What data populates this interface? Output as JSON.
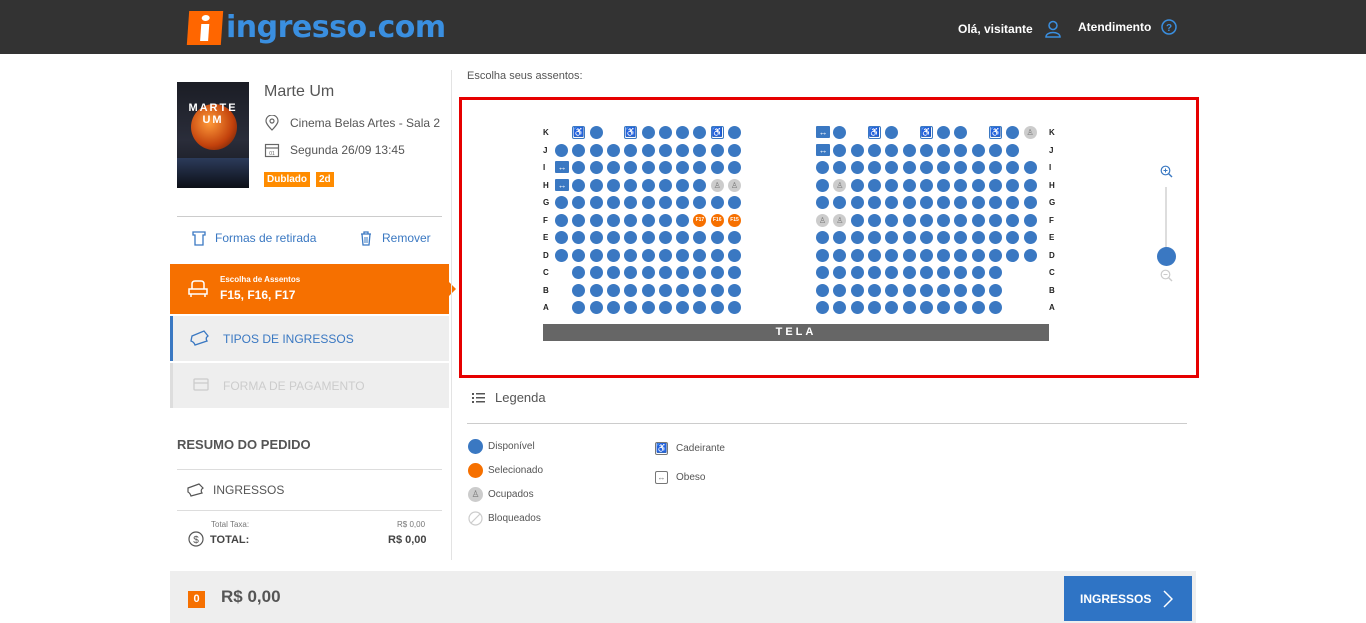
{
  "header": {
    "logo_text": "ingresso.com",
    "greeting": "Olá, visitante",
    "support_label": "Atendimento"
  },
  "movie": {
    "poster_title": "MARTE UM",
    "title": "Marte Um",
    "cinema": "Cinema Belas Artes - Sala 2",
    "session": "Segunda 26/09 13:45",
    "tags": [
      "Dublado",
      "2d"
    ]
  },
  "actions": {
    "pickup_label": "Formas de retirada",
    "remove_label": "Remover"
  },
  "steps": {
    "active_small": "Escolha de Assentos",
    "active_seats": "F15, F16, F17",
    "tickets_label": "TIPOS DE INGRESSOS",
    "payment_label": "FORMA DE PAGAMENTO"
  },
  "summary": {
    "title": "RESUMO DO PEDIDO",
    "tickets_label": "INGRESSOS",
    "fee_label": "Total Taxa:",
    "fee_value": "R$ 0,00",
    "total_label": "TOTAL:",
    "total_value": "R$ 0,00"
  },
  "seatmap": {
    "prompt": "Escolha seus assentos:",
    "screen_label": "TELA",
    "rows": [
      "K",
      "J",
      "I",
      "H",
      "G",
      "F",
      "E",
      "D",
      "C",
      "B",
      "A"
    ],
    "selected_seats": [
      "F17",
      "F16",
      "F15"
    ]
  },
  "legend": {
    "title": "Legenda",
    "available": "Disponível",
    "selected": "Selecionado",
    "occupied": "Ocupados",
    "blocked": "Bloqueados",
    "wheelchair": "Cadeirante",
    "obese": "Obeso"
  },
  "footer": {
    "count": "0",
    "price": "R$ 0,00",
    "button_label": "INGRESSOS"
  },
  "colors": {
    "brand_orange": "#f67000",
    "seat_blue": "#3a78c2",
    "highlight_red": "#e60000"
  }
}
